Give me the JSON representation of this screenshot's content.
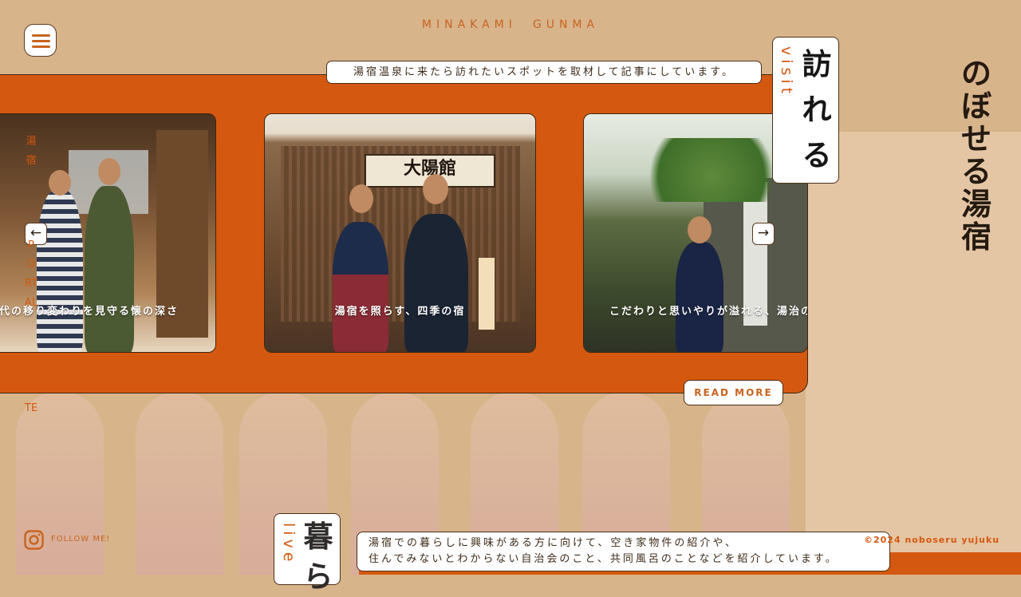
{
  "header": {
    "region_title": "MINAKAMI　GUNMA"
  },
  "logo": {
    "text": "のぼせる湯宿"
  },
  "visit": {
    "caption": "湯宿温泉に来たら訪れたいスポットを取材して記事にしています。",
    "label_en": "visit",
    "label_jp": "訪れる",
    "cards": [
      {
        "title": "代の移り変わりを見守る懐の深さ"
      },
      {
        "title": "湯宿を照らす、四季の宿"
      },
      {
        "title": "こだわりと思いやりが溢れる、湯治の"
      }
    ],
    "read_more": "READ MORE"
  },
  "side_nav": {
    "top_text": "湯宿",
    "bottom_text": "PORTAL",
    "tail_text": "TE"
  },
  "icons": {
    "menu": "hamburger-icon",
    "prev": "arrow-left-icon",
    "next": "arrow-right-icon",
    "instagram": "instagram-icon"
  },
  "arrows": {
    "prev": "←",
    "next": "→"
  },
  "footer": {
    "follow": "FOLLOW ME!",
    "copyright": "©2024 noboseru yujuku"
  },
  "live": {
    "label_en": "live",
    "label_jp": "暮ら",
    "caption_line1": "湯宿での暮らしに興味がある方に向けて、空き家物件の紹介や、",
    "caption_line2": "住んでみないとわからない自治会のこと、共同風呂のことなどを紹介しています。"
  },
  "colors": {
    "accent": "#d4580f",
    "background": "#d8b48b",
    "text": "#3d2a18"
  }
}
